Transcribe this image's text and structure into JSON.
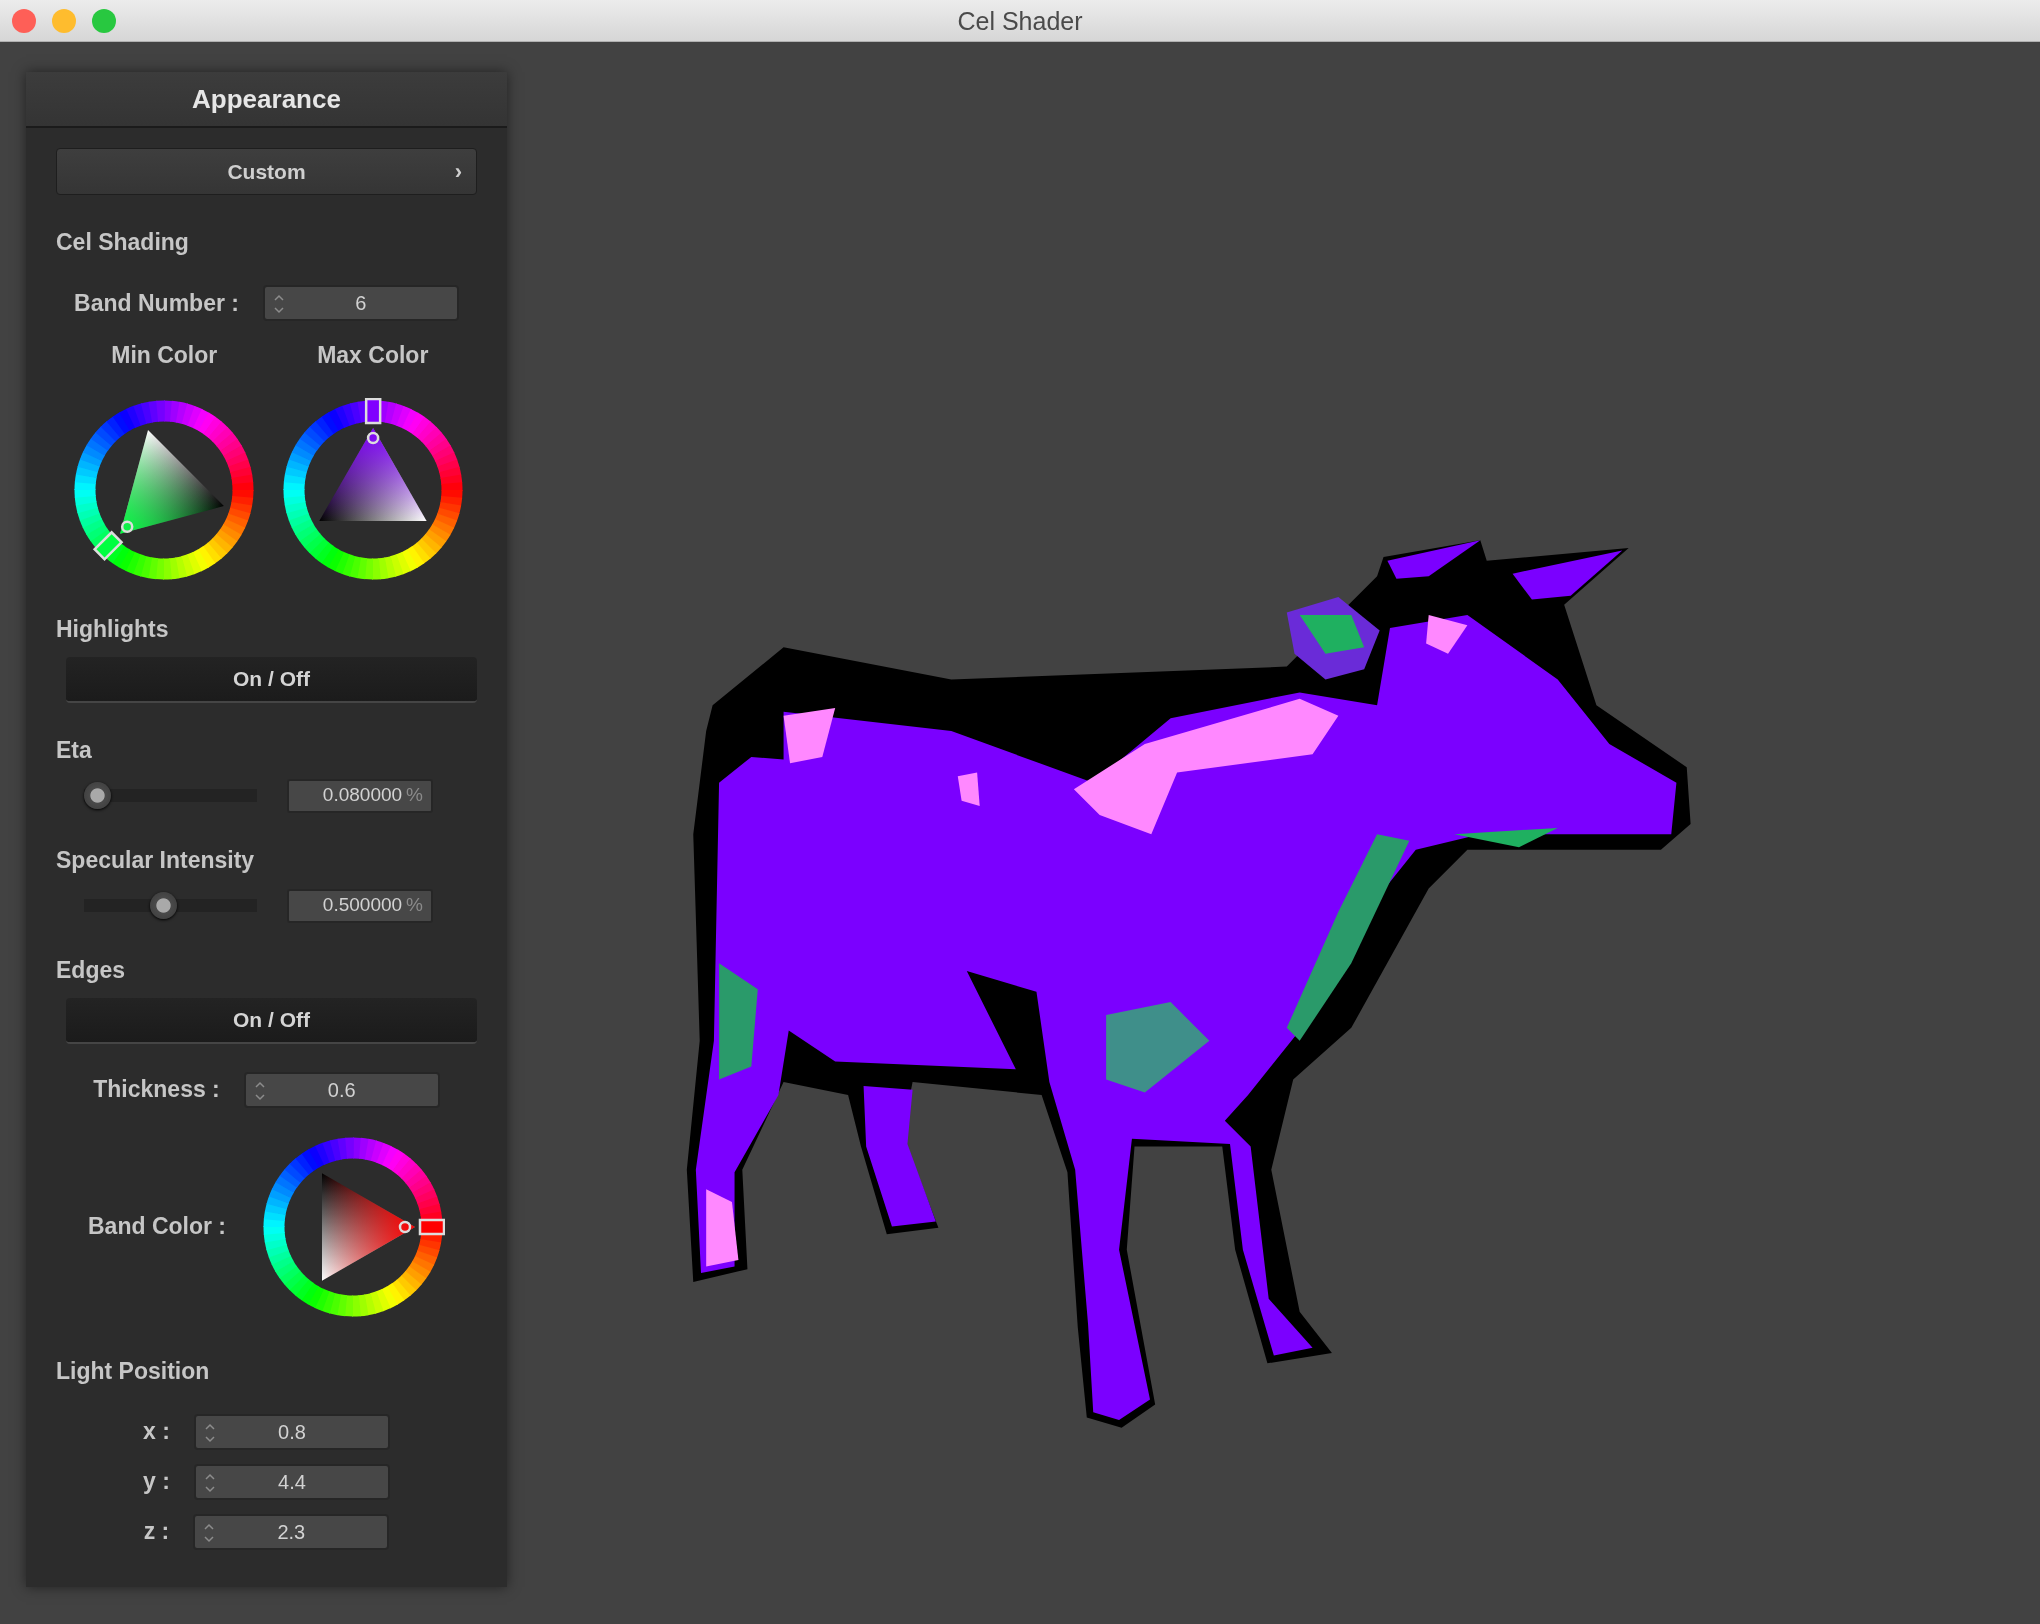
{
  "window": {
    "title": "Cel Shader"
  },
  "panel": {
    "title": "Appearance",
    "preset_button": {
      "label": "Custom",
      "chevron": "›"
    },
    "controls": [
      {
        "kind": "heading",
        "text": "Cel Shading"
      },
      {
        "kind": "spin",
        "label": "Band Number :",
        "value": "6"
      },
      {
        "kind": "color_pair",
        "pickers": [
          {
            "label": "Min Color",
            "color": "#00ff40"
          },
          {
            "label": "Max Color",
            "color": "#8000ff"
          }
        ]
      },
      {
        "kind": "heading",
        "text": "Highlights"
      },
      {
        "kind": "toggle",
        "label": "On / Off"
      },
      {
        "kind": "heading",
        "text": "Eta"
      },
      {
        "kind": "slider",
        "level": 0.0,
        "reading": "0.080000",
        "unit": "%"
      },
      {
        "kind": "heading",
        "text": "Specular Intensity"
      },
      {
        "kind": "slider",
        "level": 0.45,
        "reading": "0.500000",
        "unit": "%"
      },
      {
        "kind": "heading",
        "text": "Edges"
      },
      {
        "kind": "toggle",
        "label": "On / Off"
      },
      {
        "kind": "spin",
        "label": "Thickness :",
        "value": "0.6"
      },
      {
        "kind": "color_row",
        "label": "Band Color :",
        "color": "#ff0000"
      },
      {
        "kind": "heading",
        "text": "Light Position"
      },
      {
        "kind": "axis_spin",
        "label": "x :",
        "value": "0.8"
      },
      {
        "kind": "axis_spin",
        "label": "y :",
        "value": "4.4"
      },
      {
        "kind": "axis_spin",
        "label": "z :",
        "value": "2.3"
      }
    ]
  }
}
